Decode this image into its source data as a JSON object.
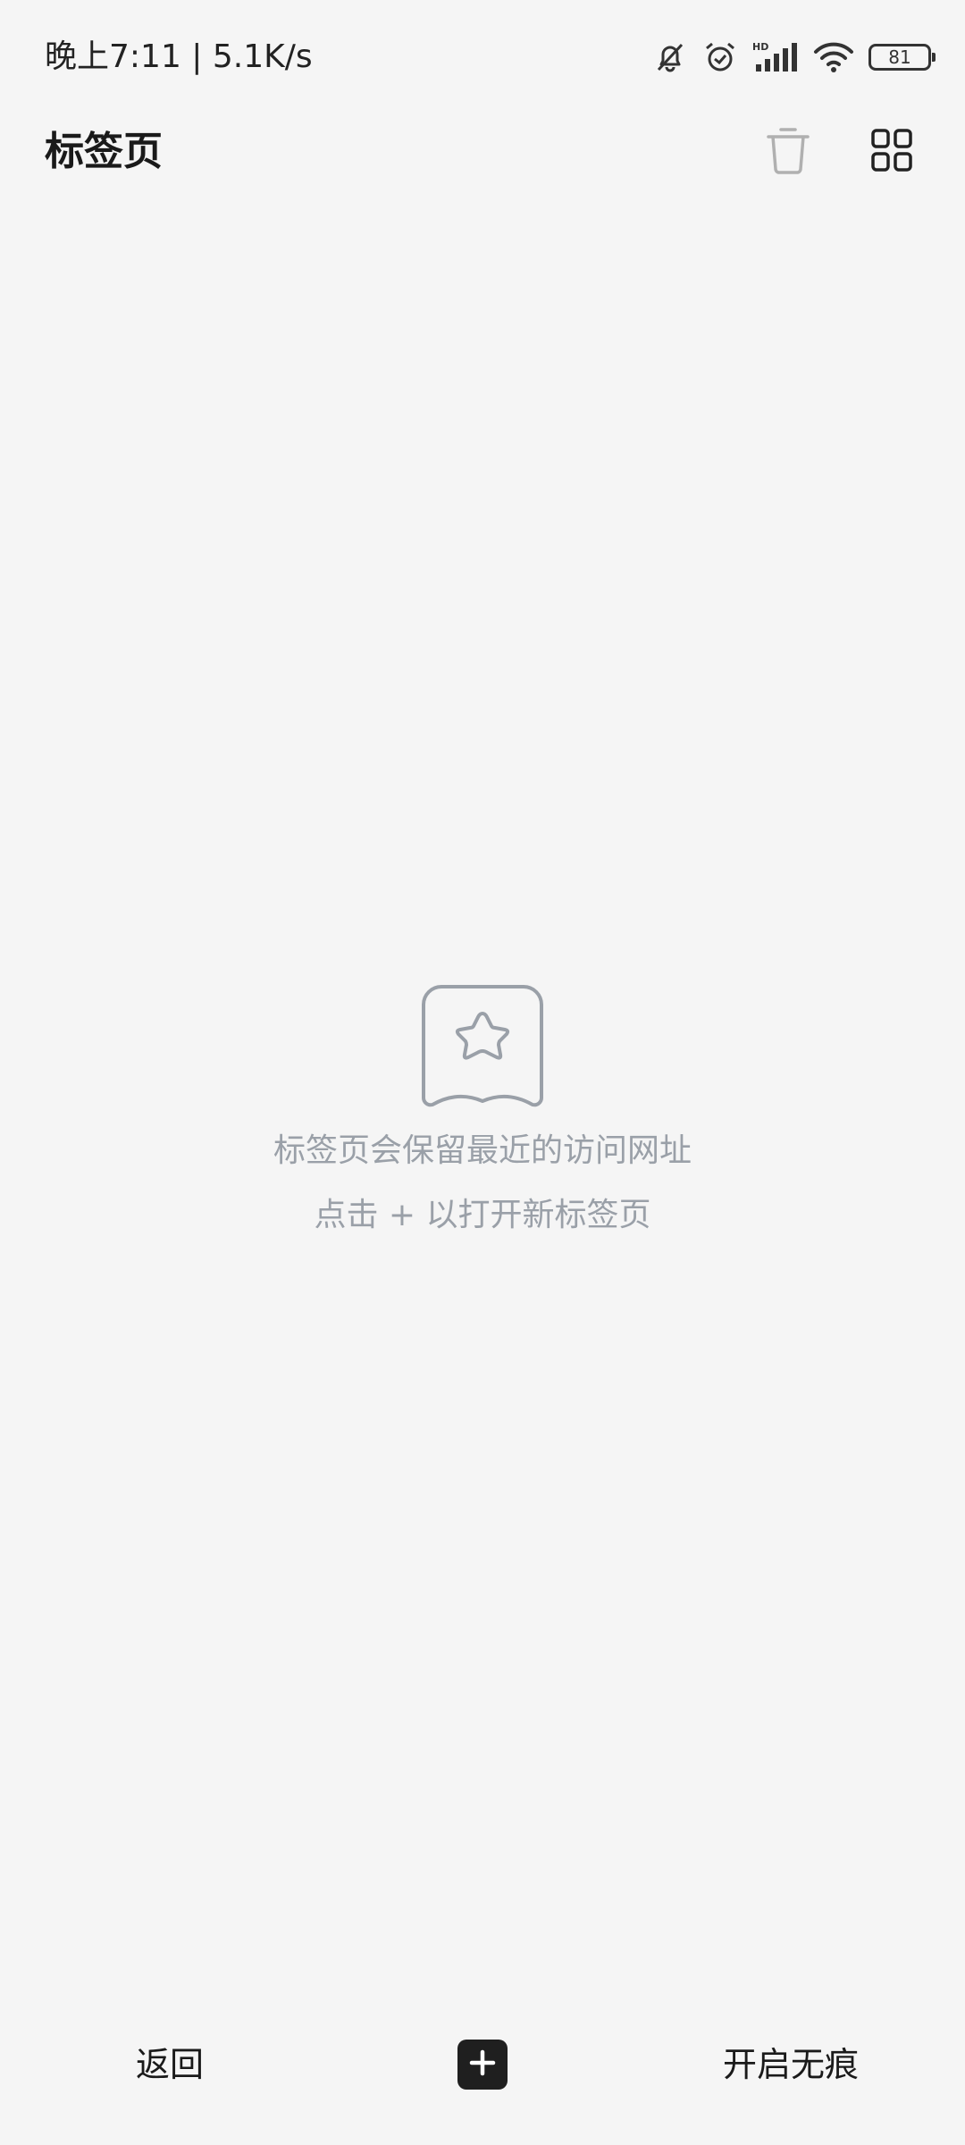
{
  "status_bar": {
    "time_text": "晚上7:11 | 5.1K/s",
    "battery_level": "81",
    "icons": [
      "bell-off-icon",
      "alarm-icon",
      "hd-signal-icon",
      "wifi-icon",
      "battery-icon"
    ]
  },
  "header": {
    "title": "标签页",
    "icons": [
      "trash-icon",
      "grid-icon"
    ]
  },
  "empty_state": {
    "icon": "star-bookmark-icon",
    "line1": "标签页会保留最近的访问网址",
    "line2": "点击 + 以打开新标签页"
  },
  "bottom_bar": {
    "back_label": "返回",
    "new_tab_icon": "plus-icon",
    "incognito_label": "开启无痕"
  },
  "colors": {
    "background": "#f5f5f5",
    "primary_text": "#1a1a1a",
    "hint_text": "#9aa0a8",
    "disabled_icon": "#b0b0b0"
  }
}
